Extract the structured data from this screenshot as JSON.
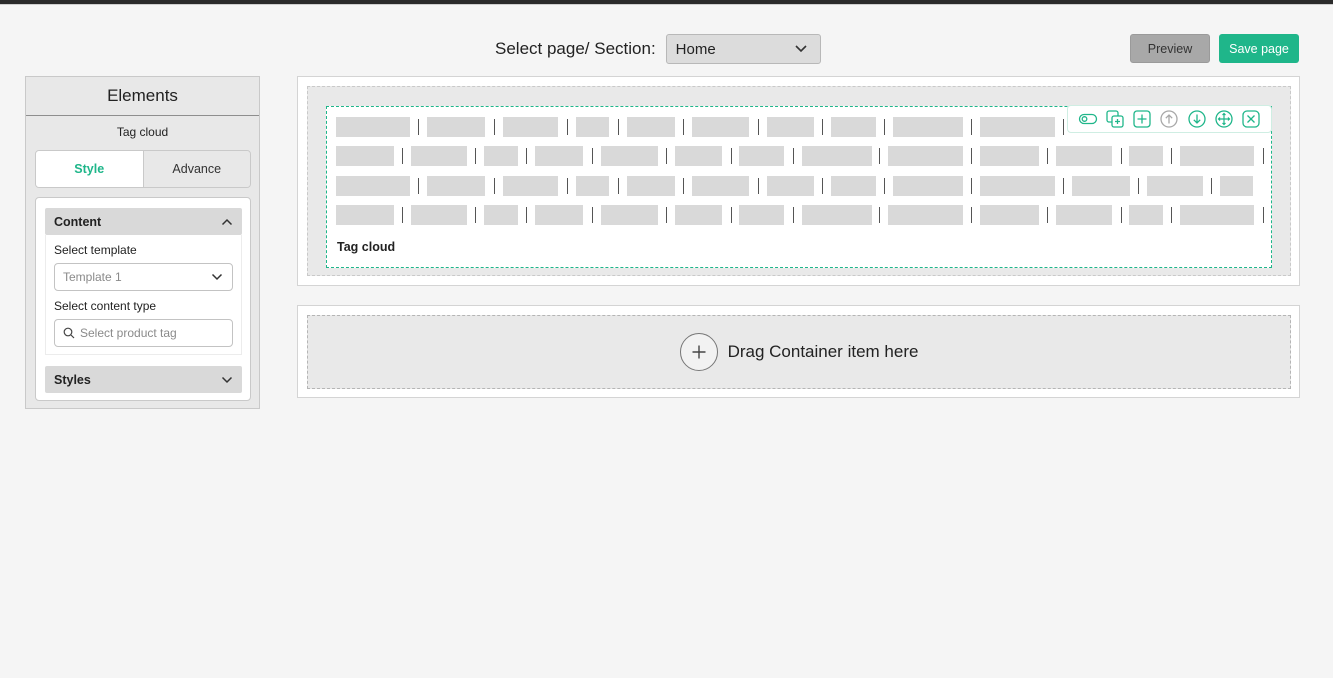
{
  "header": {
    "select_label": "Select page/ Section:",
    "selected_page": "Home",
    "preview_label": "Preview",
    "save_label": "Save page"
  },
  "sidebar": {
    "title": "Elements",
    "subtitle": "Tag cloud",
    "tabs": [
      {
        "label": "Style",
        "active": true
      },
      {
        "label": "Advance",
        "active": false
      }
    ],
    "content": {
      "heading": "Content",
      "template_label": "Select template",
      "template_value": "Template 1",
      "content_type_label": "Select content type",
      "content_type_placeholder": "Select product tag"
    },
    "styles": {
      "heading": "Styles"
    }
  },
  "canvas": {
    "widget_title": "Tag cloud",
    "toolbar_icons": [
      "toggle-icon",
      "duplicate-icon",
      "add-icon",
      "move-up-icon",
      "move-down-icon",
      "drag-move-icon",
      "close-icon"
    ],
    "drop_text": "Drag Container item here"
  },
  "colors": {
    "accent": "#1fb68a",
    "preview_bg": "#a8a8a8",
    "tag_placeholder": "#d9d9d9"
  }
}
